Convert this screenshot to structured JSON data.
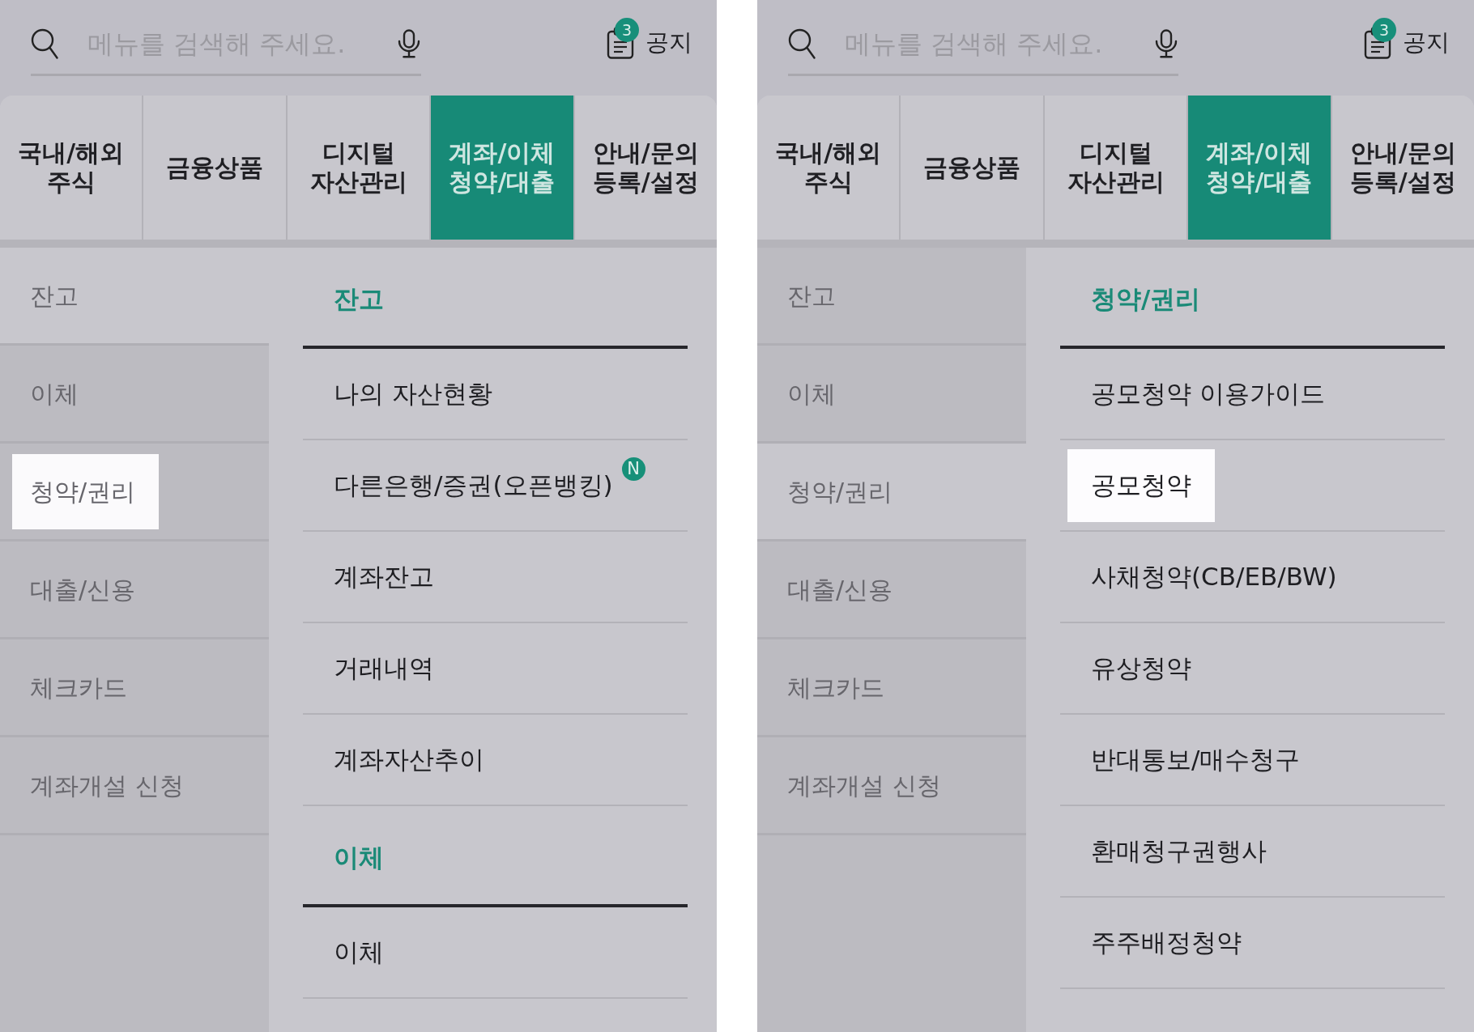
{
  "screens": [
    {
      "search": {
        "placeholder": "메뉴를 검색해 주세요."
      },
      "notice": {
        "label": "공지",
        "count": "3"
      },
      "tabs": [
        {
          "lines": [
            "국내/해외",
            "주식"
          ],
          "selected": false
        },
        {
          "lines": [
            "금융상품"
          ],
          "selected": false
        },
        {
          "lines": [
            "디지털",
            "자산관리"
          ],
          "selected": false
        },
        {
          "lines": [
            "계좌/이체",
            "청약/대출"
          ],
          "selected": true
        },
        {
          "lines": [
            "안내/문의",
            "등록/설정"
          ],
          "selected": false
        }
      ],
      "side_menu": [
        {
          "label": "잔고",
          "selected": true,
          "highlighted": false
        },
        {
          "label": "이체",
          "selected": false,
          "highlighted": false
        },
        {
          "label": "청약/권리",
          "selected": false,
          "highlighted": true
        },
        {
          "label": "대출/신용",
          "selected": false,
          "highlighted": false
        },
        {
          "label": "체크카드",
          "selected": false,
          "highlighted": false
        },
        {
          "label": "계좌개설 신청",
          "selected": false,
          "highlighted": false
        }
      ],
      "sections": [
        {
          "title": "잔고",
          "items": [
            {
              "label": "나의 자산현황",
              "highlighted": false
            },
            {
              "label": "다른은행/증권(오픈뱅킹)",
              "highlighted": false,
              "badge": "N"
            },
            {
              "label": "계좌잔고",
              "highlighted": false
            },
            {
              "label": "거래내역",
              "highlighted": false
            },
            {
              "label": "계좌자산추이",
              "highlighted": false
            }
          ]
        },
        {
          "title": "이체",
          "items": [
            {
              "label": "이체",
              "highlighted": false
            }
          ]
        }
      ]
    },
    {
      "search": {
        "placeholder": "메뉴를 검색해 주세요."
      },
      "notice": {
        "label": "공지",
        "count": "3"
      },
      "tabs": [
        {
          "lines": [
            "국내/해외",
            "주식"
          ],
          "selected": false
        },
        {
          "lines": [
            "금융상품"
          ],
          "selected": false
        },
        {
          "lines": [
            "디지털",
            "자산관리"
          ],
          "selected": false
        },
        {
          "lines": [
            "계좌/이체",
            "청약/대출"
          ],
          "selected": true
        },
        {
          "lines": [
            "안내/문의",
            "등록/설정"
          ],
          "selected": false
        }
      ],
      "side_menu": [
        {
          "label": "잔고",
          "selected": false,
          "highlighted": false
        },
        {
          "label": "이체",
          "selected": false,
          "highlighted": false
        },
        {
          "label": "청약/권리",
          "selected": true,
          "highlighted": false
        },
        {
          "label": "대출/신용",
          "selected": false,
          "highlighted": false
        },
        {
          "label": "체크카드",
          "selected": false,
          "highlighted": false
        },
        {
          "label": "계좌개설 신청",
          "selected": false,
          "highlighted": false
        }
      ],
      "sections": [
        {
          "title": "청약/권리",
          "items": [
            {
              "label": "공모청약 이용가이드",
              "highlighted": false
            },
            {
              "label": "공모청약",
              "highlighted": true
            },
            {
              "label": "사채청약(CB/EB/BW)",
              "highlighted": false
            },
            {
              "label": "유상청약",
              "highlighted": false
            },
            {
              "label": "반대통보/매수청구",
              "highlighted": false
            },
            {
              "label": "환매청구권행사",
              "highlighted": false
            },
            {
              "label": "주주배정청약",
              "highlighted": false
            }
          ]
        }
      ]
    }
  ]
}
